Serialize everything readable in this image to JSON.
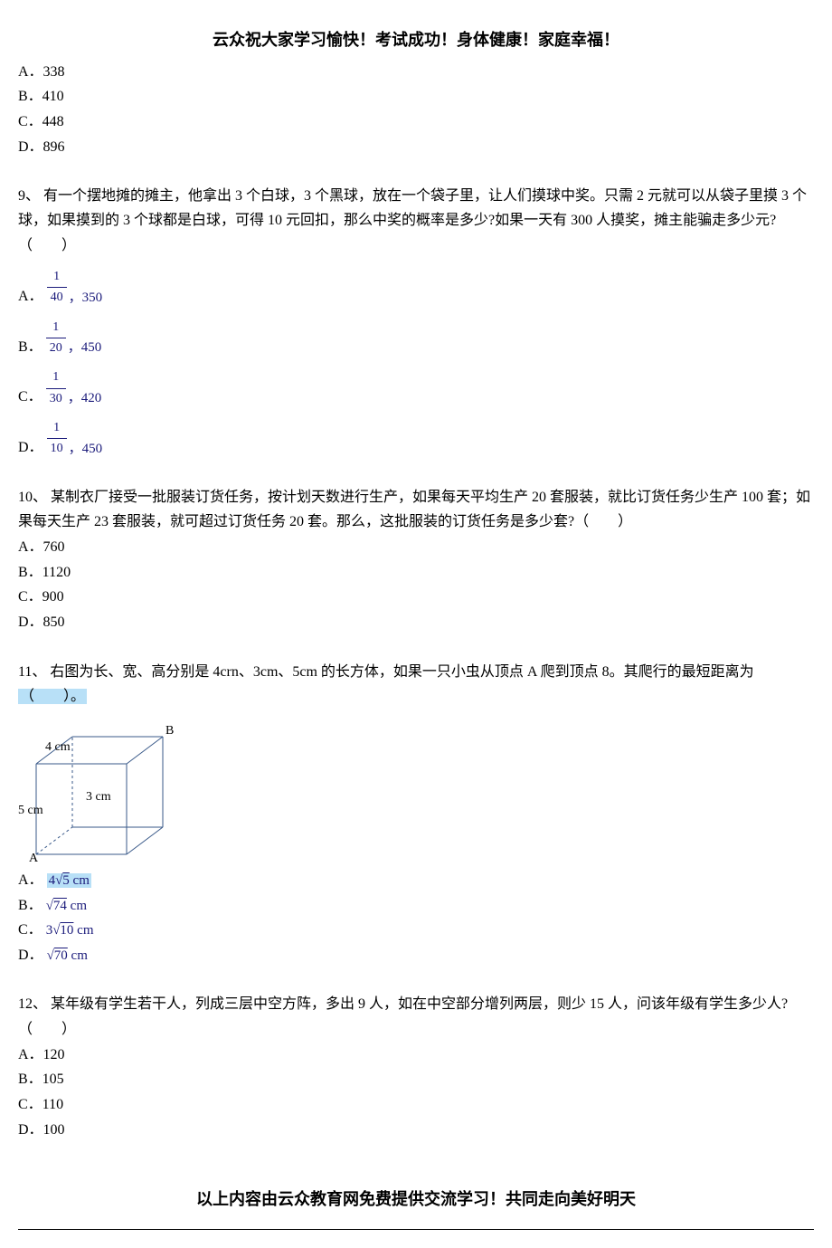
{
  "header": "云众祝大家学习愉快！考试成功！身体健康！家庭幸福！",
  "q8_options": {
    "a": "A．338",
    "b": "B．410",
    "c": "C．448",
    "d": "D．896"
  },
  "q9": {
    "text": "9、 有一个摆地摊的摊主，他拿出 3 个白球，3 个黑球，放在一个袋子里，让人们摸球中奖。只需 2 元就可以从袋子里摸 3 个球，如果摸到的 3 个球都是白球，可得 10 元回扣，那么中奖的概率是多少?如果一天有 300 人摸奖，摊主能骗走多少元?（　　）",
    "optA_letter": "A．",
    "optA_num": "1",
    "optA_den": "40",
    "optA_val": "，350",
    "optB_letter": "B．",
    "optB_num": "1",
    "optB_den": "20",
    "optB_val": "，450",
    "optC_letter": "C．",
    "optC_num": "1",
    "optC_den": "30",
    "optC_val": "，420",
    "optD_letter": "D．",
    "optD_num": "1",
    "optD_den": "10",
    "optD_val": "，450"
  },
  "q10": {
    "text": "10、 某制衣厂接受一批服装订货任务，按计划天数进行生产，如果每天平均生产 20 套服装，就比订货任务少生产 100 套；如果每天生产 23 套服装，就可超过订货任务 20 套。那么，这批服装的订货任务是多少套?（　　）",
    "a": "A．760",
    "b": "B．1120",
    "c": "C．900",
    "d": "D．850"
  },
  "q11": {
    "text_before": "11、 右图为长、宽、高分别是 4crn、3cm、5cm 的长方体，如果一只小虫从顶点 A 爬到顶点 8。其爬行的最短距离为",
    "text_highlight": "（　　）。",
    "label_4cm": "4 cm",
    "label_3cm": "3 cm",
    "label_5cm": "5 cm",
    "label_A": "A",
    "label_B": "B",
    "optA_letter": "A．",
    "optA_formula": "4√5 cm",
    "optB_letter": "B．",
    "optB_formula": "√74 cm",
    "optC_letter": "C．",
    "optC_formula": "3√10 cm",
    "optD_letter": "D．",
    "optD_formula": "√70 cm"
  },
  "q12": {
    "text": "12、 某年级有学生若干人，列成三层中空方阵，多出 9 人，如在中空部分增列两层，则少 15 人，问该年级有学生多少人?（　　）",
    "a": "A．120",
    "b": "B．105",
    "c": "C．110",
    "d": "D．100"
  },
  "footer": "以上内容由云众教育网免费提供交流学习！共同走向美好明天"
}
